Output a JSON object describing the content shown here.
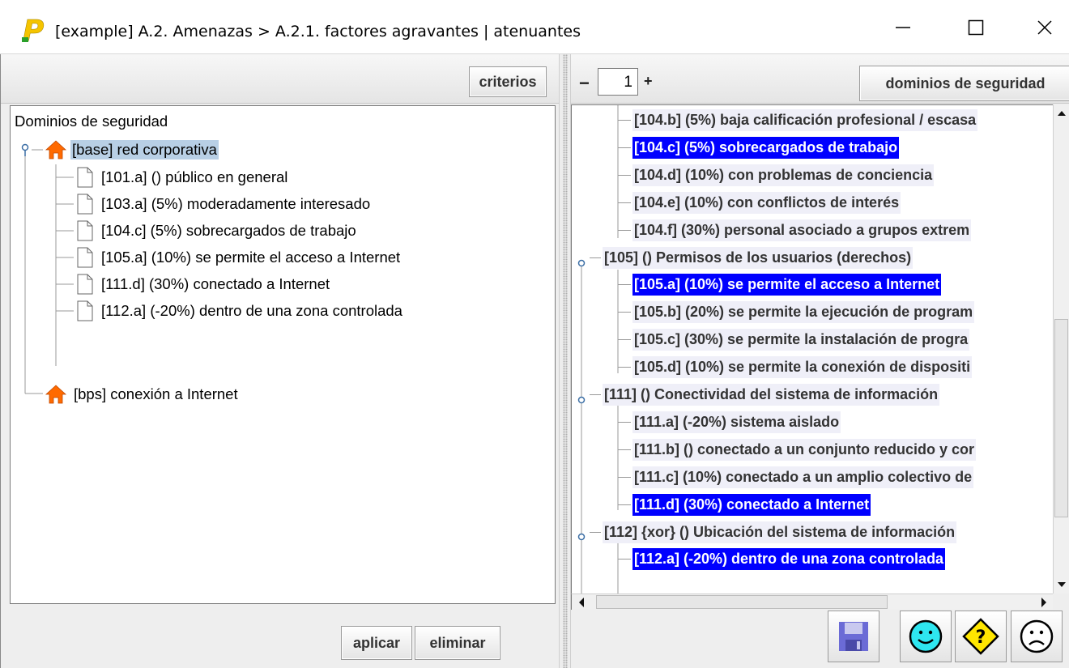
{
  "window": {
    "title": "[example] A.2. Amenazas > A.2.1. factores agravantes | atenuantes",
    "logo_letter": "P",
    "controls": [
      "minimize",
      "maximize",
      "close"
    ]
  },
  "left_panel": {
    "criterios_label": "criterios",
    "tree": {
      "root_label": "Dominios de seguridad",
      "nodes": [
        {
          "label": "[base] red corporativa",
          "icon": "home-icon",
          "selected": true,
          "children": [
            {
              "label": "[101.a] () público en general",
              "icon": "document-icon"
            },
            {
              "label": "[103.a] (5%) moderadamente interesado",
              "icon": "document-icon"
            },
            {
              "label": "[104.c] (5%) sobrecargados de trabajo",
              "icon": "document-icon"
            },
            {
              "label": "[105.a] (10%) se permite el acceso a Internet",
              "icon": "document-icon"
            },
            {
              "label": "[111.d] (30%) conectado a Internet",
              "icon": "document-icon"
            },
            {
              "label": "[112.a] (-20%) dentro de una zona controlada",
              "icon": "document-icon"
            }
          ]
        },
        {
          "label": "[bps] conexión a Internet",
          "icon": "home-icon",
          "selected": false
        }
      ]
    },
    "aplicar_label": "aplicar",
    "eliminar_label": "eliminar"
  },
  "right_panel": {
    "spinner_minus": "−",
    "spinner_value": "1",
    "spinner_plus": "+",
    "dominios_label": "dominios de seguridad",
    "tree_rows": [
      {
        "label": "[104.b] (5%) baja calificación profesional / escasa",
        "level": 2,
        "style": "alt"
      },
      {
        "label": "[104.c] (5%) sobrecargados de trabajo",
        "level": 2,
        "style": "hi"
      },
      {
        "label": "[104.d] (10%) con problemas de conciencia",
        "level": 2,
        "style": "alt"
      },
      {
        "label": "[104.e] (10%) con conflictos de interés",
        "level": 2,
        "style": "alt"
      },
      {
        "label": "[104.f] (30%) personal asociado a grupos extrem",
        "level": 2,
        "style": "alt",
        "last": true
      },
      {
        "label": "[105] () Permisos de los usuarios (derechos)",
        "level": 1,
        "style": "alt"
      },
      {
        "label": "[105.a] (10%) se permite el acceso a Internet",
        "level": 2,
        "style": "hi"
      },
      {
        "label": "[105.b] (20%) se permite la ejecución de program",
        "level": 2,
        "style": "alt"
      },
      {
        "label": "[105.c] (30%) se permite la instalación de progra",
        "level": 2,
        "style": "alt"
      },
      {
        "label": "[105.d] (10%) se permite la conexión de dispositi",
        "level": 2,
        "style": "alt",
        "last": true
      },
      {
        "label": "[111] () Conectividad del sistema de información",
        "level": 1,
        "style": "alt"
      },
      {
        "label": "[111.a] (-20%) sistema aislado",
        "level": 2,
        "style": "alt"
      },
      {
        "label": "[111.b] () conectado a un conjunto reducido y cor",
        "level": 2,
        "style": "alt"
      },
      {
        "label": "[111.c] (10%) conectado a un amplio colectivo de",
        "level": 2,
        "style": "alt"
      },
      {
        "label": "[111.d] (30%) conectado a Internet",
        "level": 2,
        "style": "hi",
        "last": true
      },
      {
        "label": "[112] {xor} () Ubicación del sistema de información",
        "level": 1,
        "style": "alt"
      },
      {
        "label": "[112.a] (-20%) dentro de una zona controlada",
        "level": 2,
        "style": "hi"
      }
    ],
    "buttons": [
      "save-icon",
      "happy-face-icon",
      "question-warning-icon",
      "sad-face-icon"
    ]
  },
  "colors": {
    "highlight": "#0000ff",
    "selection_light": "#b8cfe5",
    "alt_row": "#efeff8",
    "home_icon": "#ff6600",
    "logo": "#f2c200"
  }
}
